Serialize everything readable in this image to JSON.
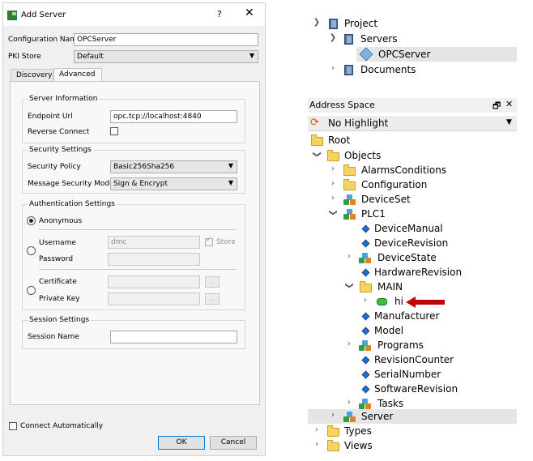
{
  "dialog": {
    "title": "Add Server",
    "help": "?",
    "close": "✕",
    "config_name_label": "Configuration Name",
    "config_name_value": "OPCServer",
    "pki_label": "PKI Store",
    "pki_value": "Default",
    "tabs": [
      {
        "label": "Discovery"
      },
      {
        "label": "Advanced"
      }
    ],
    "server_info": {
      "title": "Server Information",
      "endpoint_label": "Endpoint Url",
      "endpoint_value": "opc.tcp://localhost:4840",
      "reverse_label": "Reverse Connect"
    },
    "security": {
      "title": "Security Settings",
      "policy_label": "Security Policy",
      "policy_value": "Basic256Sha256",
      "mode_label": "Message Security Mode",
      "mode_value": "Sign & Encrypt"
    },
    "auth": {
      "title": "Authentication Settings",
      "anonymous": "Anonymous",
      "username_label": "Username",
      "username_value": "dmc",
      "store_label": "Store",
      "password_label": "Password",
      "certificate_label": "Certificate",
      "private_key_label": "Private Key",
      "browse": "..."
    },
    "session": {
      "title": "Session Settings",
      "name_label": "Session Name"
    },
    "connect_auto": "Connect Automatically",
    "ok": "OK",
    "cancel": "Cancel"
  },
  "project_tree": {
    "items": [
      {
        "label": "Project"
      },
      {
        "label": "Servers"
      },
      {
        "label": "OPCServer"
      },
      {
        "label": "Documents"
      }
    ]
  },
  "address_space": {
    "title": "Address Space",
    "float_icon": "🗗",
    "close_icon": "✕",
    "highlight_value": "No Highlight",
    "items": [
      {
        "label": "Root"
      },
      {
        "label": "Objects"
      },
      {
        "label": "AlarmsConditions"
      },
      {
        "label": "Configuration"
      },
      {
        "label": "DeviceSet"
      },
      {
        "label": "PLC1"
      },
      {
        "label": "DeviceManual"
      },
      {
        "label": "DeviceRevision"
      },
      {
        "label": "DeviceState"
      },
      {
        "label": "HardwareRevision"
      },
      {
        "label": "MAIN"
      },
      {
        "label": "hi"
      },
      {
        "label": "Manufacturer"
      },
      {
        "label": "Model"
      },
      {
        "label": "Programs"
      },
      {
        "label": "RevisionCounter"
      },
      {
        "label": "SerialNumber"
      },
      {
        "label": "SoftwareRevision"
      },
      {
        "label": "Tasks"
      },
      {
        "label": "Server"
      },
      {
        "label": "Types"
      },
      {
        "label": "Views"
      }
    ]
  },
  "colors": {
    "selection": "#e5e5e5",
    "arrow": "#c00000",
    "primary_border": "#0078d7"
  }
}
